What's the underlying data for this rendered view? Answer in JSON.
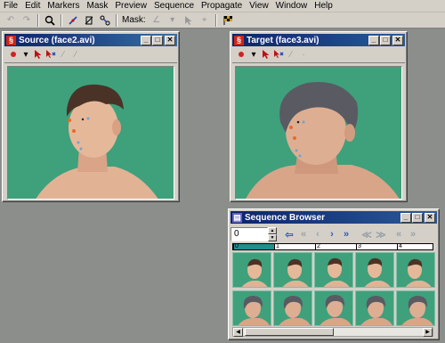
{
  "menu": [
    "File",
    "Edit",
    "Markers",
    "Mask",
    "Preview",
    "Sequence",
    "Propagate",
    "View",
    "Window",
    "Help"
  ],
  "toolbar": {
    "mask_label": "Mask:"
  },
  "source_window": {
    "title": "Source (face2.avi)"
  },
  "target_window": {
    "title": "Target (face3.avi)"
  },
  "sequence_browser": {
    "title": "Sequence Browser",
    "frame_value": "0",
    "timeline_ticks": [
      "0",
      "1",
      "2",
      "3",
      "4"
    ],
    "thumbnail_columns": 5,
    "thumbnail_rows": 2
  },
  "colors": {
    "background_green": "#3fa07c",
    "titlebar_active": "#0a246a",
    "marker_red": "#d42020",
    "window_face": "#d4d0c8"
  },
  "icons": [
    "undo-icon",
    "redo-icon",
    "zoom-icon",
    "marker-tool-icon",
    "mask-tool-icon",
    "link-tool-icon",
    "pointer-icon",
    "checkered-flag-icon"
  ]
}
